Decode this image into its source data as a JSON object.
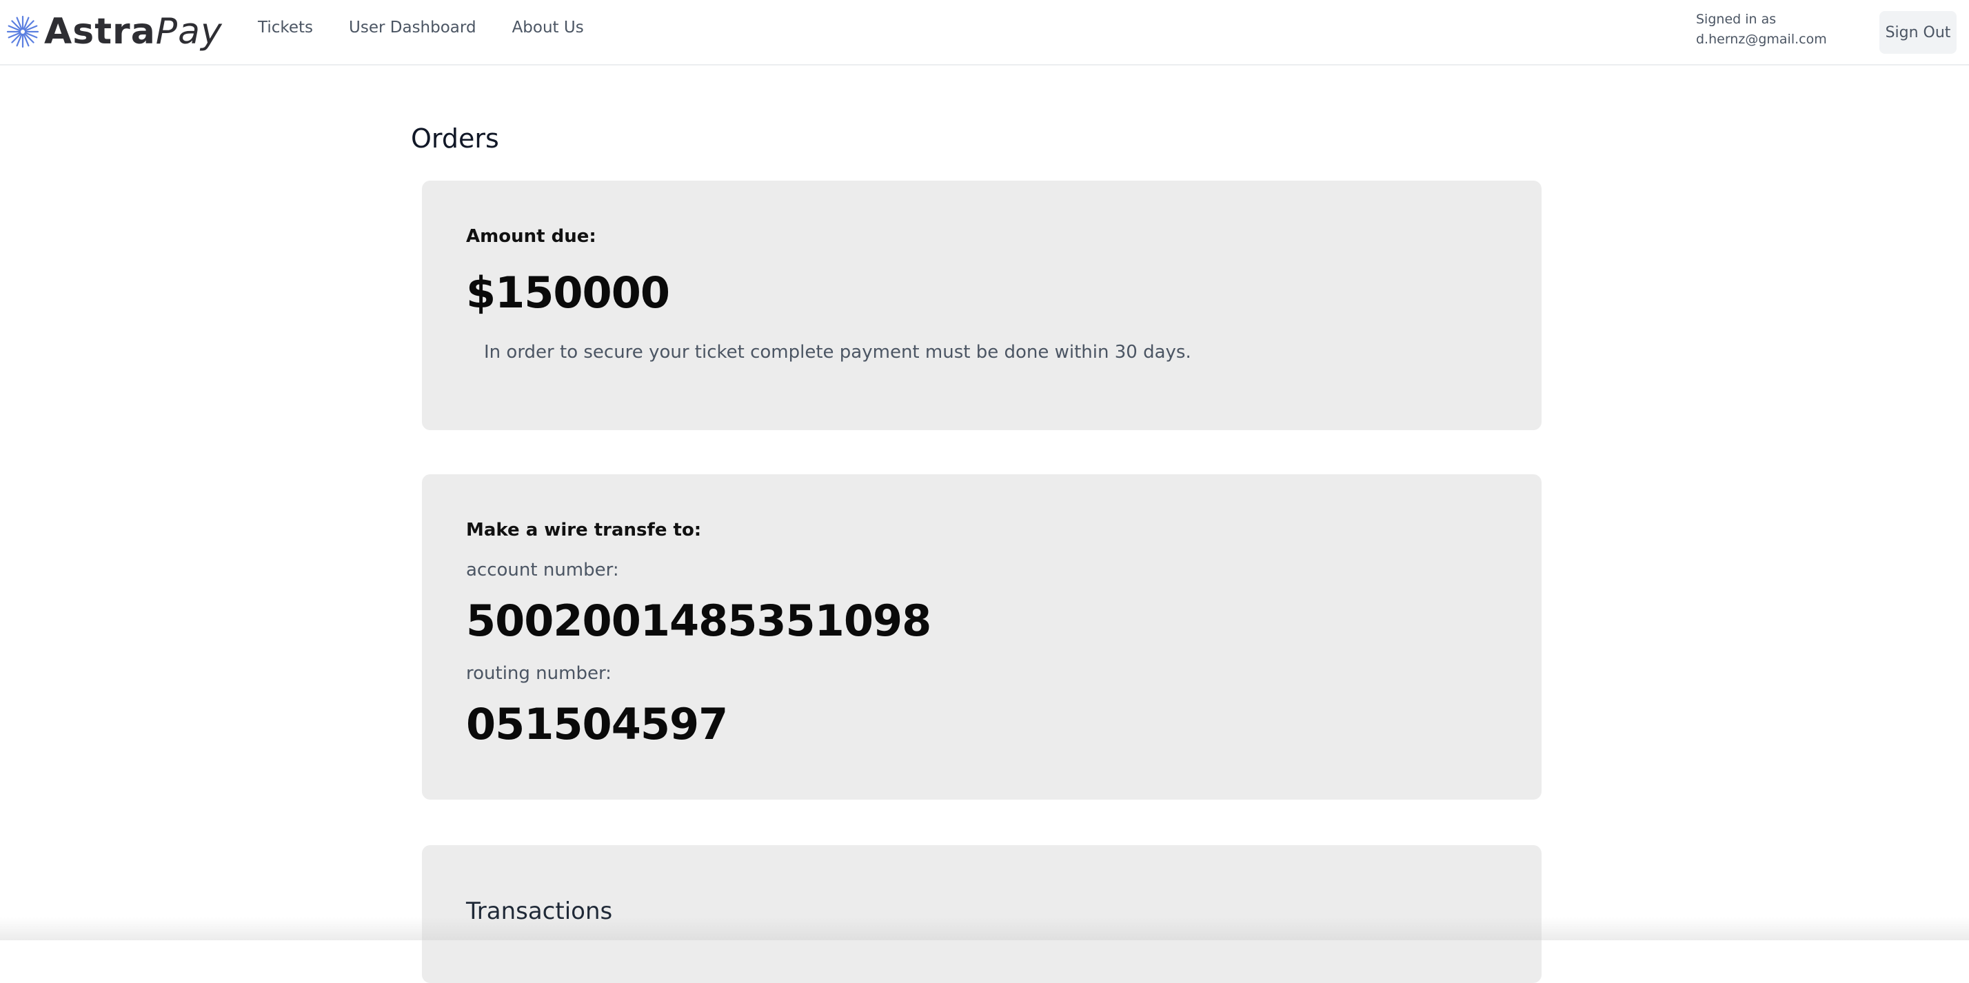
{
  "brand": {
    "name_part1": "Astra",
    "name_part2": "Pay",
    "accent_color": "#5b7fe0"
  },
  "nav": {
    "items": [
      {
        "label": "Tickets"
      },
      {
        "label": "User Dashboard"
      },
      {
        "label": "About Us"
      }
    ]
  },
  "user": {
    "signed_in_label": "Signed in as",
    "email": "d.hernz@gmail.com",
    "sign_out_label": "Sign Out"
  },
  "page": {
    "title": "Orders"
  },
  "amount_card": {
    "label": "Amount due:",
    "amount": "$150000",
    "note": "In order to secure your ticket complete payment must be done within 30 days."
  },
  "wire_card": {
    "title": "Make a wire transfe to:",
    "account_label": "account number:",
    "account_number": "5002001485351098",
    "routing_label": "routing number:",
    "routing_number": "051504597"
  },
  "transactions_card": {
    "title": "Transactions"
  }
}
